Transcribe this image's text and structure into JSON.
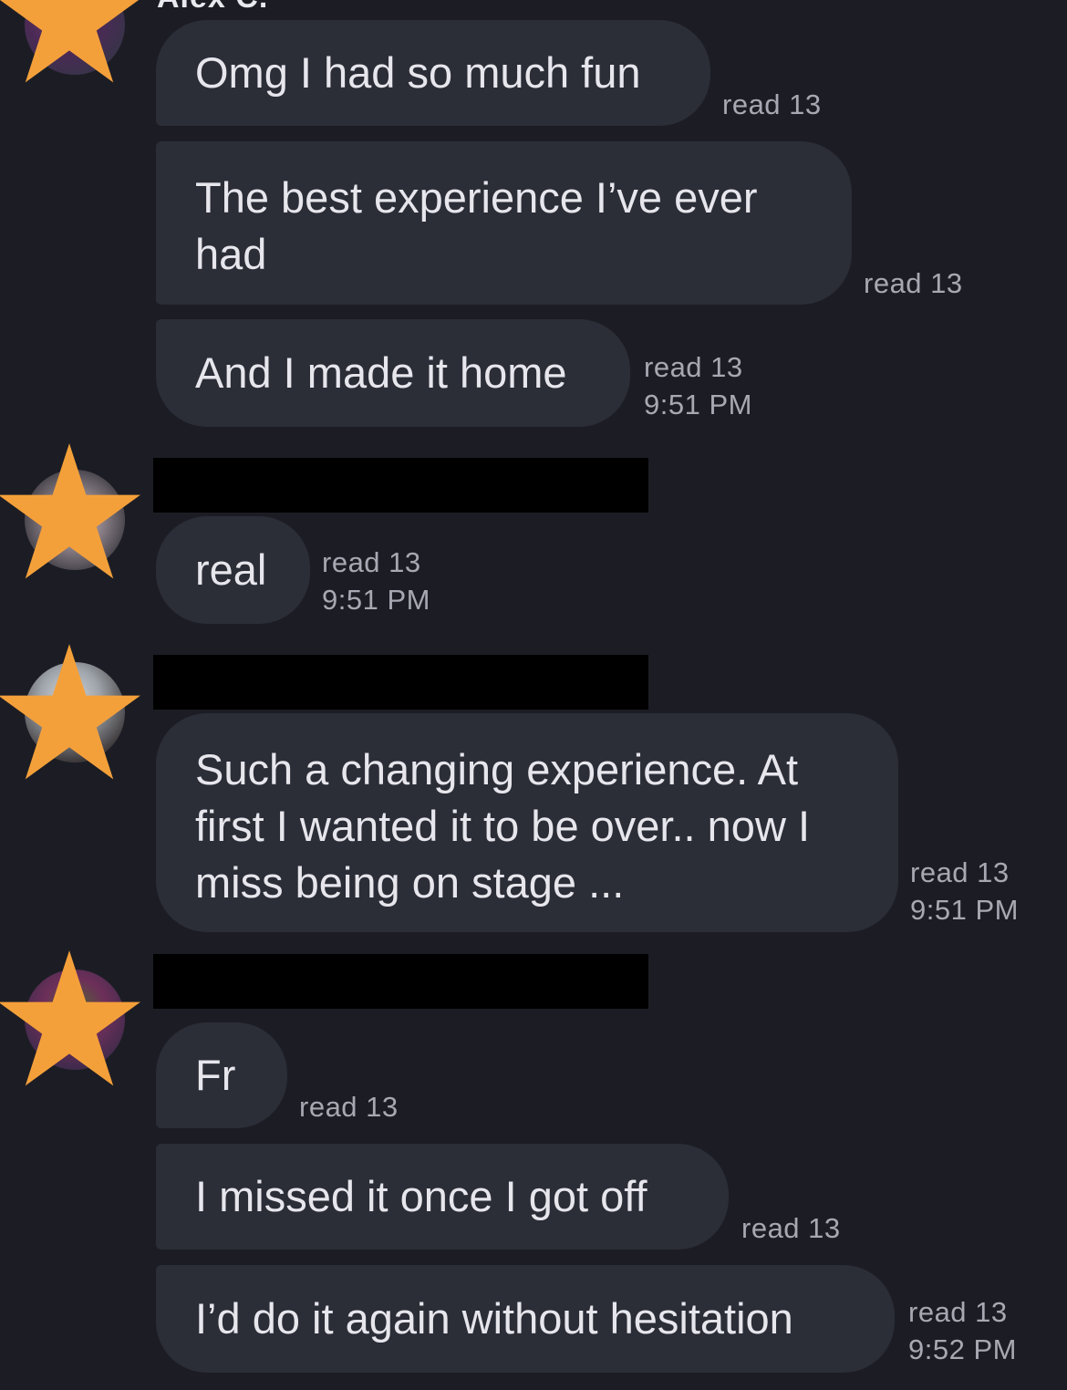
{
  "top_sender": {
    "name": "Alex C."
  },
  "groups": [
    {
      "messages": [
        {
          "text": "Omg I had so much fun",
          "read": "read 13"
        },
        {
          "text": "The best experience I’ve ever had",
          "read": "read 13"
        },
        {
          "text": "And I made it home",
          "read": "read 13",
          "time": "9:51 PM"
        }
      ]
    },
    {
      "messages": [
        {
          "text": "real",
          "read": "read 13",
          "time": "9:51 PM"
        }
      ]
    },
    {
      "messages": [
        {
          "text": "Such a changing experience. At first I wanted it to be over.. now I miss being on stage ...",
          "read": "read 13",
          "time": "9:51 PM"
        }
      ]
    },
    {
      "messages": [
        {
          "text": "Fr",
          "read": "read 13"
        },
        {
          "text": "I missed it once I got off",
          "read": "read 13"
        },
        {
          "text": "I’d do it again without hesitation",
          "read": "read 13",
          "time": "9:52 PM"
        }
      ]
    }
  ],
  "colors": {
    "background": "#1c1d24",
    "bubble": "#2b2d37",
    "text": "#e6e6ec",
    "meta": "#a7a8b2",
    "star": "#f4a03a",
    "redaction": "#000000"
  },
  "icons": {
    "star": "star-icon",
    "avatar": "avatar"
  }
}
